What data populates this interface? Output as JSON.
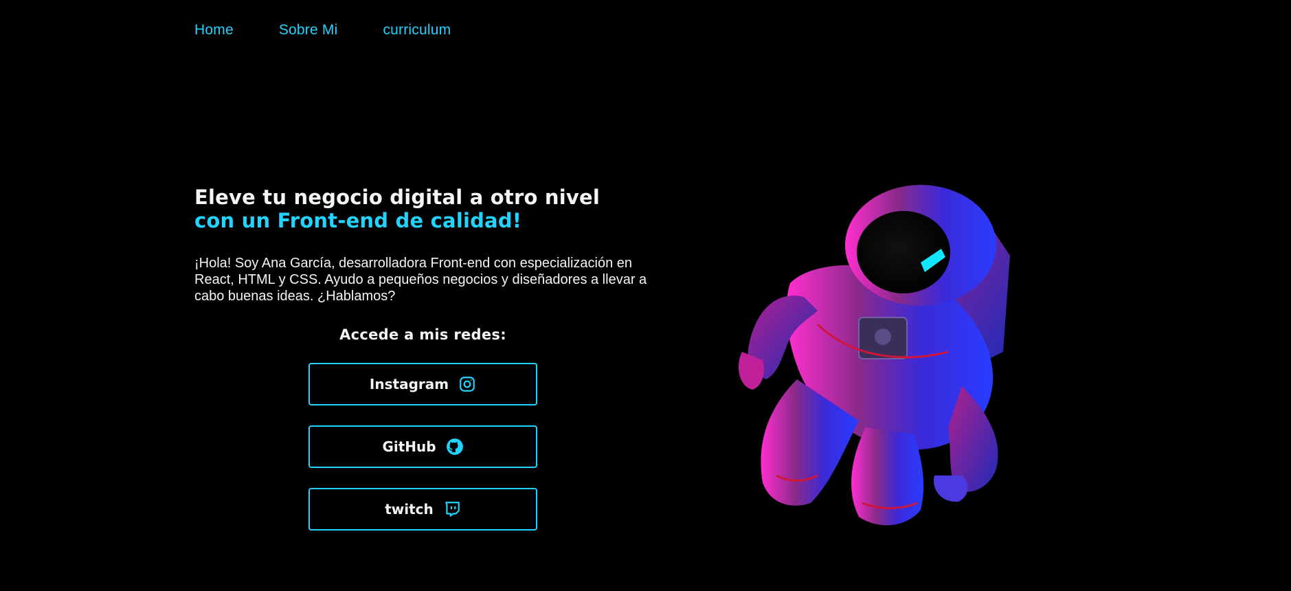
{
  "nav": {
    "items": [
      {
        "label": "Home"
      },
      {
        "label": "Sobre Mi"
      },
      {
        "label": "curriculum"
      }
    ]
  },
  "hero": {
    "title_line1": "Eleve tu negocio digital a otro nivel",
    "title_line2": "con un Front-end de calidad!",
    "intro": "¡Hola! Soy Ana García, desarrolladora Front-end con especialización en React, HTML y CSS. Ayudo a pequeños negocios y diseñadores a llevar a cabo buenas ideas. ¿Hablamos?"
  },
  "social": {
    "title": "Accede a mis redes:",
    "buttons": [
      {
        "label": "Instagram",
        "icon": "instagram-icon"
      },
      {
        "label": "GitHub",
        "icon": "github-icon"
      },
      {
        "label": "twitch",
        "icon": "twitch-icon"
      }
    ]
  },
  "colors": {
    "background": "#000000",
    "accent": "#22d4fd",
    "text": "#f5f5f5"
  }
}
